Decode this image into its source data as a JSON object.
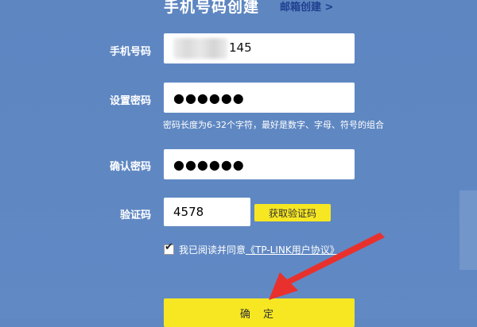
{
  "header": {
    "title": "手机号码创建",
    "email_link": "邮箱创建 >"
  },
  "form": {
    "phone": {
      "label": "手机号码",
      "value_visible": "145"
    },
    "password": {
      "label": "设置密码",
      "value_masked": "●●●●●●",
      "hint": "密码长度为6-32个字符，最好是数字、字母、符号的组合"
    },
    "confirm": {
      "label": "确认密码",
      "value_masked": "●●●●●●"
    },
    "code": {
      "label": "验证码",
      "value": "4578",
      "get_code_label": "获取验证码"
    },
    "agreement": {
      "text": "我已阅读并同意",
      "link": "《TP-LINK用户协议》"
    },
    "submit_label": "确 定"
  },
  "colors": {
    "background": "#5f87c2",
    "button_yellow": "#f7e723",
    "link_blue": "#1f3f8f",
    "arrow_red": "#e8312c"
  }
}
